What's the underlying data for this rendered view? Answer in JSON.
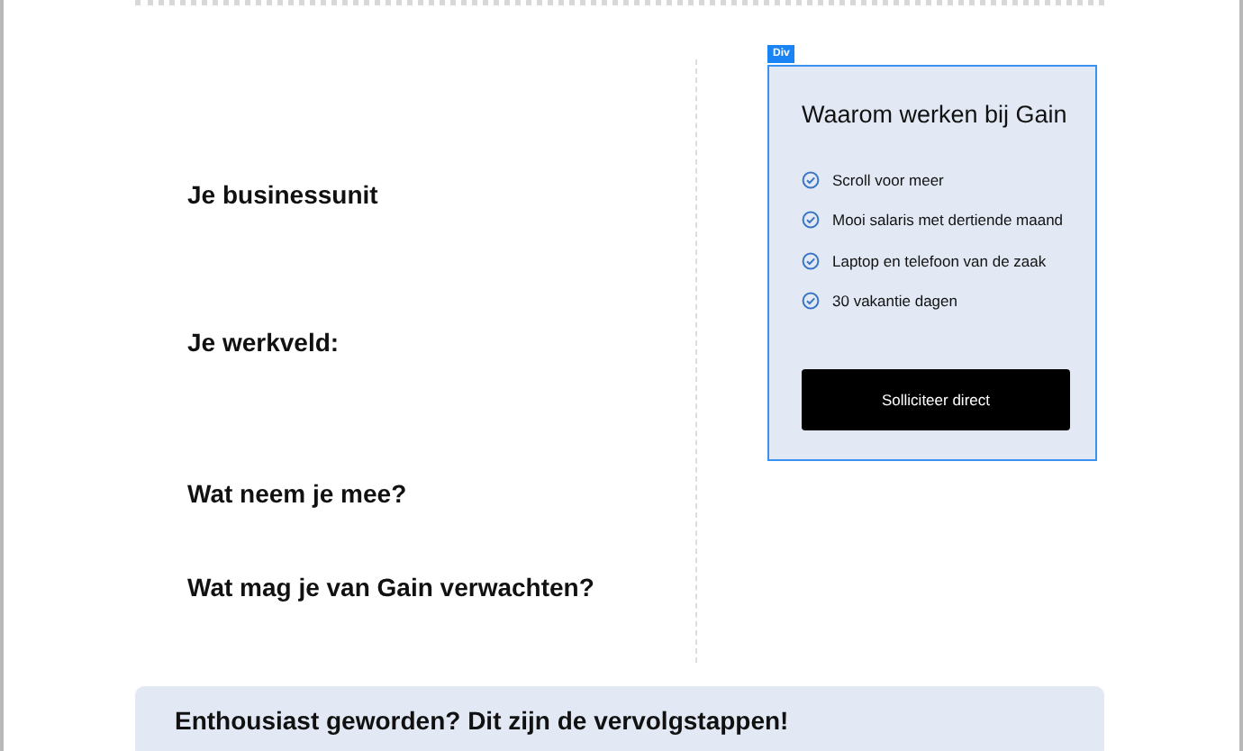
{
  "left_sections": [
    {
      "heading": "Je businessunit"
    },
    {
      "heading": "Je werkveld:"
    },
    {
      "heading": "Wat neem je mee?"
    },
    {
      "heading": "Wat mag je van Gain verwachten?"
    }
  ],
  "card": {
    "tag": "Div",
    "title": "Waarom werken bij Gain",
    "benefits": [
      "Scroll voor meer",
      "Mooi salaris met dertiende maand",
      "Laptop en telefoon van de zaak",
      "30 vakantie dagen"
    ],
    "button": "Solliciteer direct"
  },
  "next_steps": {
    "heading": "Enthousiast geworden? Dit zijn de vervolgstappen!"
  }
}
